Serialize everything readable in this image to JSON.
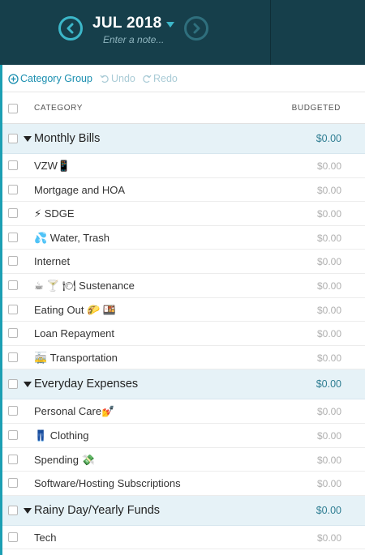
{
  "header": {
    "month": "JUL 2018",
    "note_placeholder": "Enter a note..."
  },
  "toolbar": {
    "add_category_group": "Category Group",
    "undo": "Undo",
    "redo": "Redo"
  },
  "table": {
    "col_category": "CATEGORY",
    "col_budgeted": "BUDGETED"
  },
  "rows": [
    {
      "type": "group",
      "name": "Monthly Bills",
      "budgeted": "$0.00"
    },
    {
      "type": "category",
      "name": "VZW📱",
      "budgeted": "$0.00"
    },
    {
      "type": "category",
      "name": "Mortgage and HOA",
      "budgeted": "$0.00"
    },
    {
      "type": "category",
      "name": "⚡ SDGE",
      "budgeted": "$0.00"
    },
    {
      "type": "category",
      "name": "💦 Water, Trash",
      "budgeted": "$0.00"
    },
    {
      "type": "category",
      "name": "Internet",
      "budgeted": "$0.00"
    },
    {
      "type": "category",
      "name": "☕ 🍸 🍽 Sustenance",
      "budgeted": "$0.00"
    },
    {
      "type": "category",
      "name": "Eating Out 🌮 🍱",
      "budgeted": "$0.00"
    },
    {
      "type": "category",
      "name": "Loan Repayment",
      "budgeted": "$0.00"
    },
    {
      "type": "category",
      "name": "🚋 Transportation",
      "budgeted": "$0.00"
    },
    {
      "type": "group",
      "name": "Everyday Expenses",
      "budgeted": "$0.00"
    },
    {
      "type": "category",
      "name": "Personal Care💅",
      "budgeted": "$0.00"
    },
    {
      "type": "category",
      "name": "👖 Clothing",
      "budgeted": "$0.00"
    },
    {
      "type": "category",
      "name": "Spending 💸",
      "budgeted": "$0.00"
    },
    {
      "type": "category",
      "name": "Software/Hosting Subscriptions",
      "budgeted": "$0.00"
    },
    {
      "type": "group",
      "name": "Rainy Day/Yearly Funds",
      "budgeted": "$0.00"
    },
    {
      "type": "category",
      "name": "Tech",
      "budgeted": "$0.00"
    }
  ]
}
